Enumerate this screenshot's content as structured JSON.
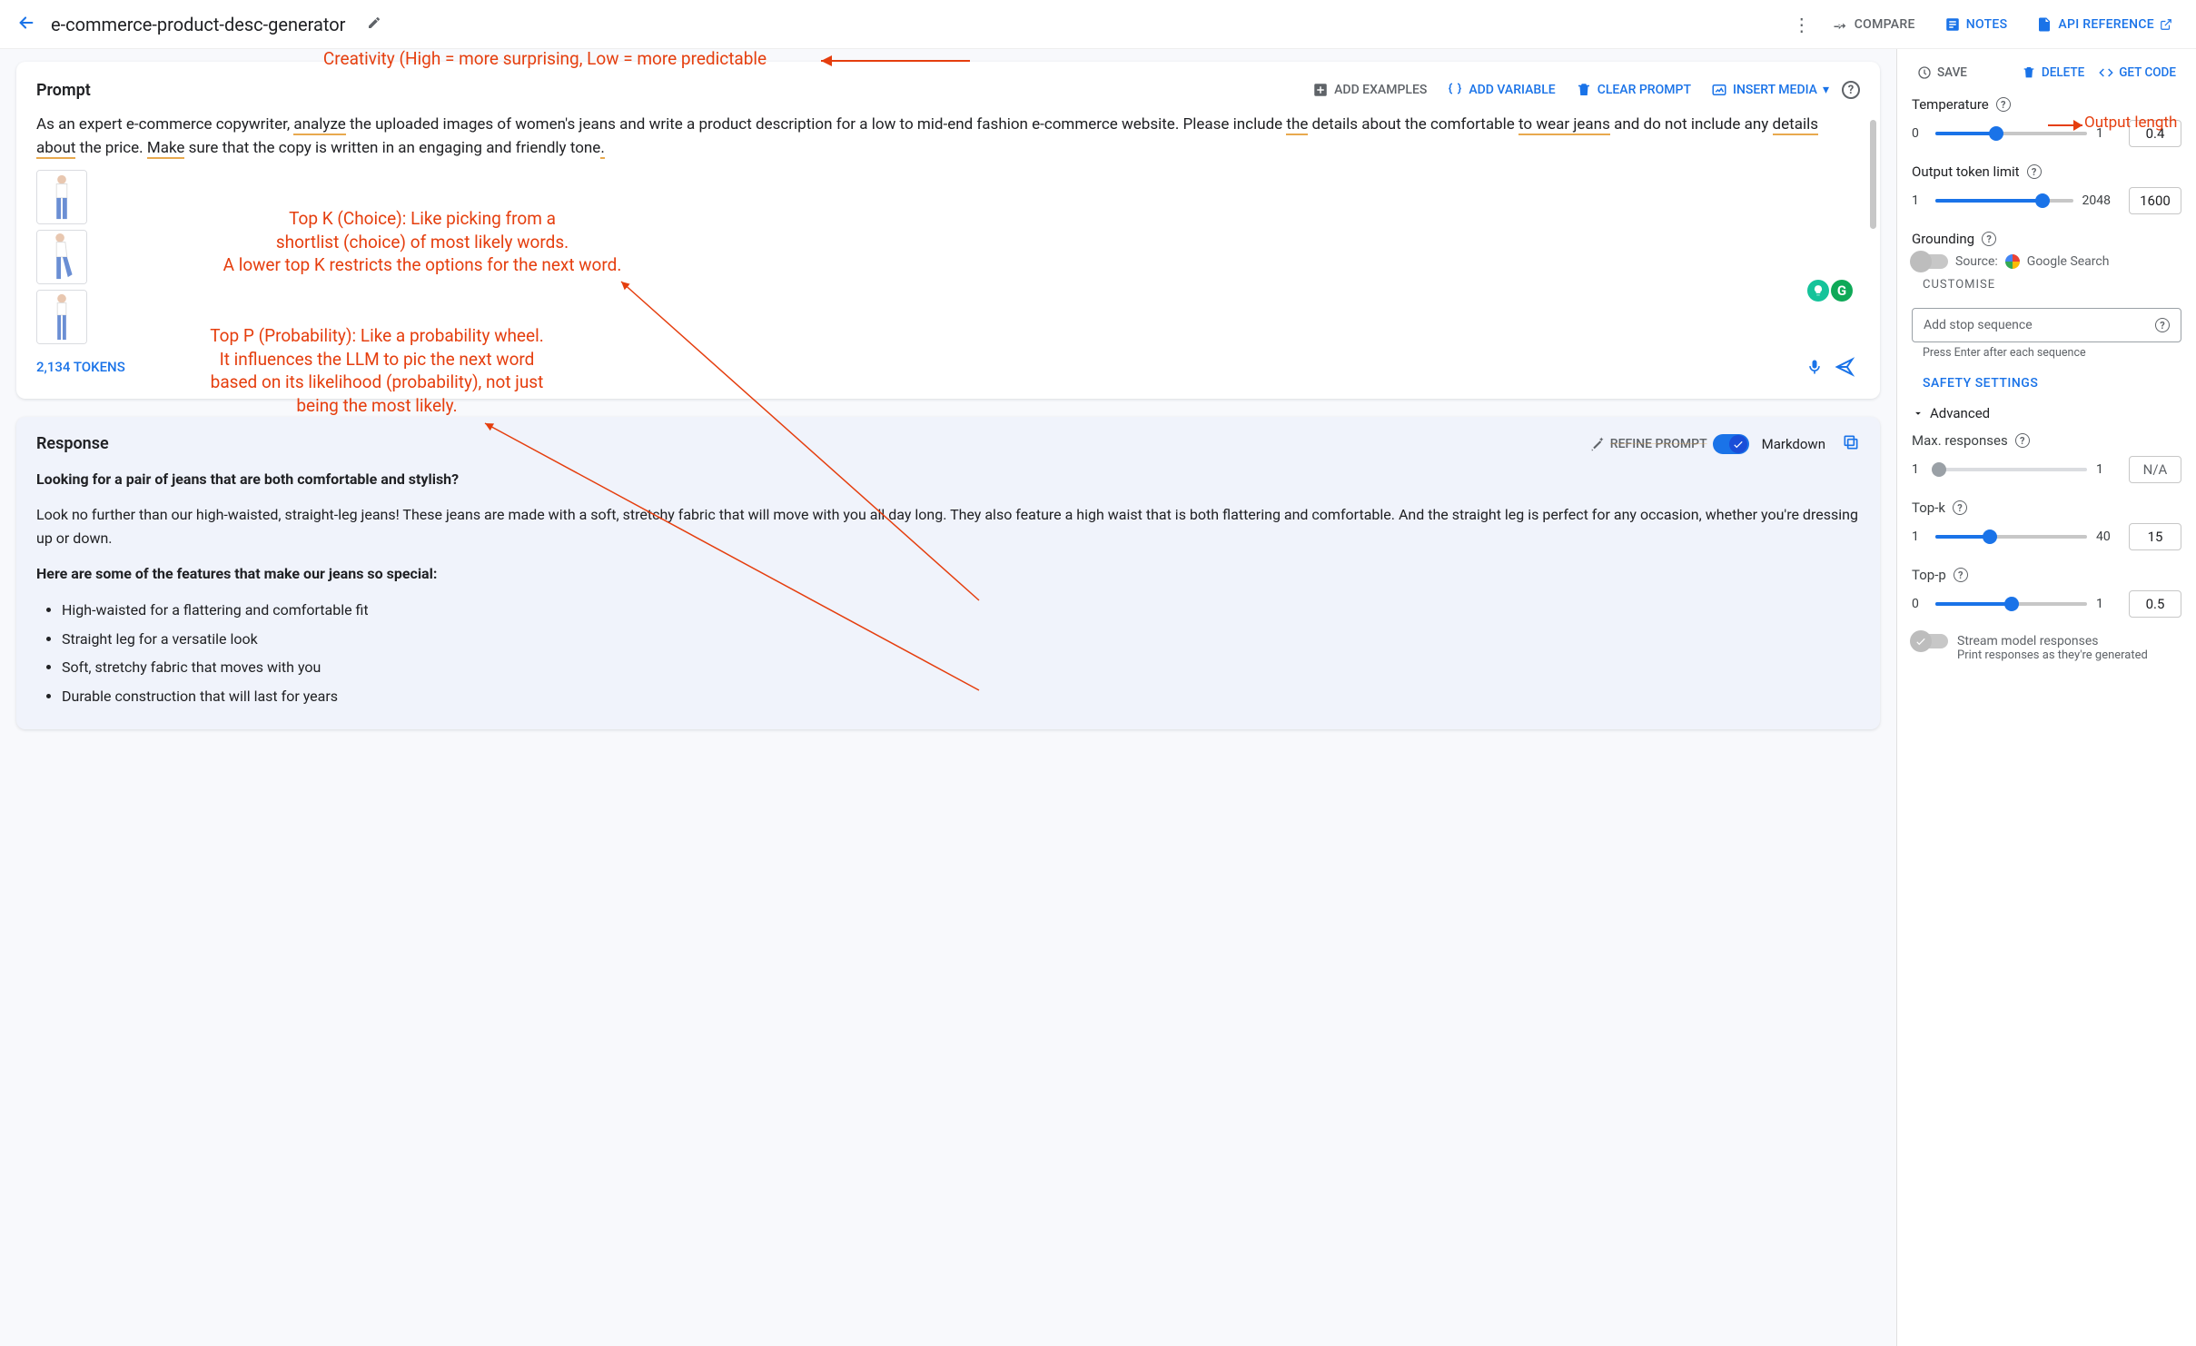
{
  "header": {
    "title": "e-commerce-product-desc-generator",
    "compare": "COMPARE",
    "notes": "NOTES",
    "api_ref": "API REFERENCE"
  },
  "prompt_card": {
    "title": "Prompt",
    "add_examples": "ADD EXAMPLES",
    "add_variable": "ADD VARIABLE",
    "clear_prompt": "CLEAR PROMPT",
    "insert_media": "INSERT MEDIA",
    "text": "As an expert e-commerce copywriter, analyze the uploaded images of women's jeans and write a product description for a low to mid-end fashion e-commerce website. Please include the details about the comfortable to wear jeans and do not include any details about the price. Make sure that the copy is written in an engaging and friendly tone.",
    "tokens": "2,134 TOKENS"
  },
  "response_card": {
    "title": "Response",
    "refine": "REFINE PROMPT",
    "markdown": "Markdown",
    "h1": "Looking for a pair of jeans that are both comfortable and stylish?",
    "p1": "Look no further than our high-waisted, straight-leg jeans! These jeans are made with a soft, stretchy fabric that will move with you all day long. They also feature a high waist that is both flattering and comfortable. And the straight leg is perfect for any occasion, whether you're dressing up or down.",
    "h2": "Here are some of the features that make our jeans so special:",
    "bullets": [
      "High-waisted for a flattering and comfortable fit",
      "Straight leg for a versatile look",
      "Soft, stretchy fabric that moves with you",
      "Durable construction that will last for years"
    ]
  },
  "panel": {
    "save": "SAVE",
    "delete": "DELETE",
    "getcode": "GET CODE",
    "temperature": {
      "label": "Temperature",
      "min": "0",
      "max": "1",
      "value": "0.4",
      "pct": 40
    },
    "output_limit": {
      "label": "Output token limit",
      "min": "1",
      "max": "2048",
      "value": "1600",
      "pct": 78
    },
    "grounding": {
      "label": "Grounding",
      "source_prefix": "Source:",
      "source_name": "Google Search",
      "customise": "CUSTOMISE"
    },
    "stopseq": {
      "placeholder": "Add stop sequence",
      "hint": "Press Enter after each sequence"
    },
    "safety": "SAFETY SETTINGS",
    "advanced": "Advanced",
    "max_responses": {
      "label": "Max. responses",
      "min": "1",
      "max": "1",
      "value": "N/A"
    },
    "topk": {
      "label": "Top-k",
      "min": "1",
      "max": "40",
      "value": "15",
      "pct": 36
    },
    "topp": {
      "label": "Top-p",
      "min": "0",
      "max": "1",
      "value": "0.5",
      "pct": 50
    },
    "stream": {
      "label": "Stream model responses",
      "hint": "Print responses as they're generated"
    }
  },
  "annotations": {
    "creativity": "Creativity (High = more surprising, Low = more predictable",
    "output_length": "Output length",
    "topk": "Top K (Choice):  Like picking from a\nshortlist (choice) of most likely words.\nA lower top K restricts the options for the next word.",
    "topp": "Top P (Probability): Like a probability wheel.\nIt influences the LLM to pic the next word\nbased on its likelihood (probability), not just\nbeing the most likely."
  }
}
